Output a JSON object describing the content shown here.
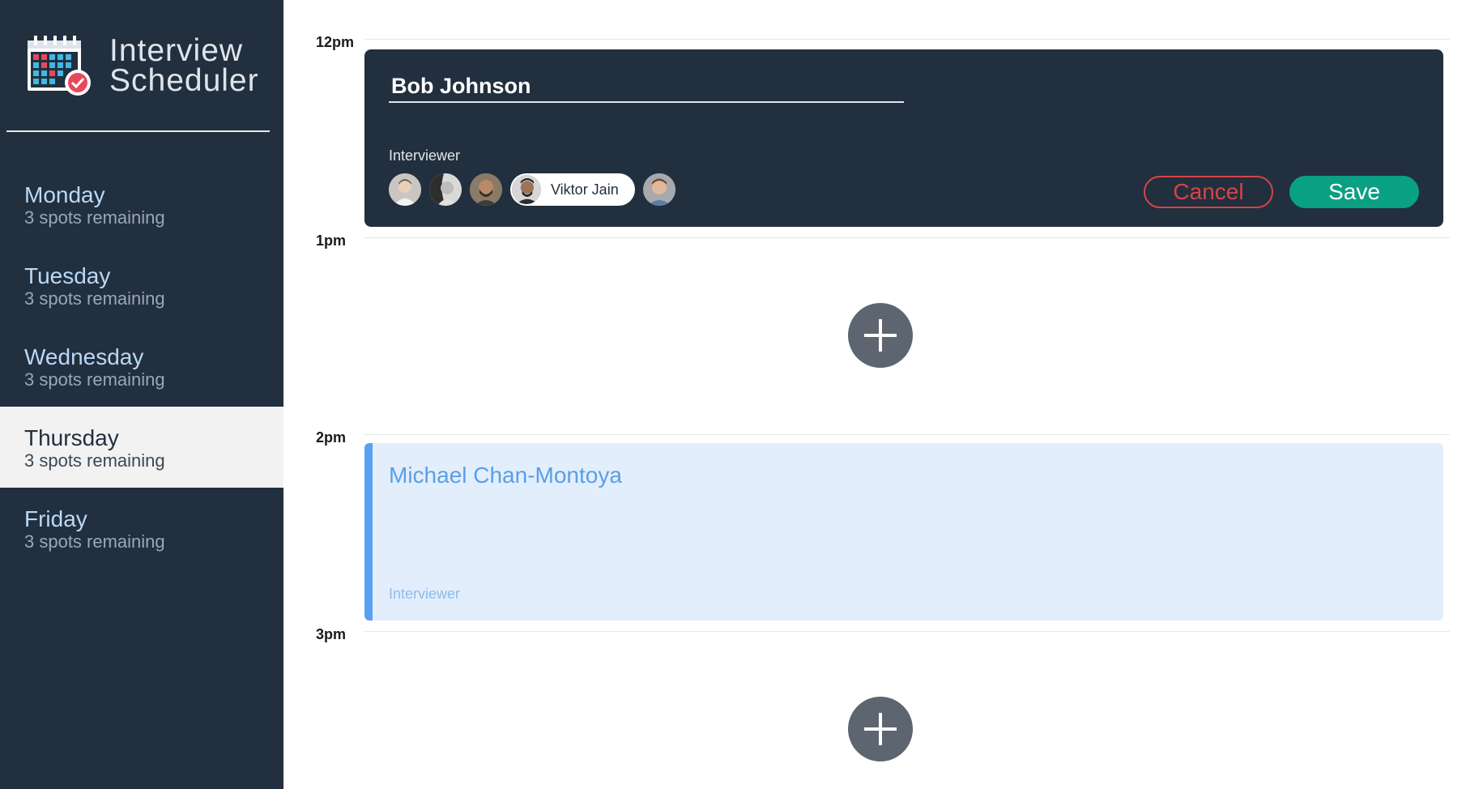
{
  "app": {
    "title_line1": "Interview",
    "title_line2": "Scheduler",
    "logo_icon": "calendar-check-icon"
  },
  "days": [
    {
      "name": "Monday",
      "spots": "3 spots remaining",
      "selected": false
    },
    {
      "name": "Tuesday",
      "spots": "3 spots remaining",
      "selected": false
    },
    {
      "name": "Wednesday",
      "spots": "3 spots remaining",
      "selected": false
    },
    {
      "name": "Thursday",
      "spots": "3 spots remaining",
      "selected": true
    },
    {
      "name": "Friday",
      "spots": "3 spots remaining",
      "selected": false
    }
  ],
  "schedule": {
    "hours": [
      "12pm",
      "1pm",
      "2pm",
      "3pm"
    ],
    "edit_form": {
      "student_name": "Bob Johnson",
      "interviewer_label": "Interviewer",
      "selected_interviewer": "Viktor Jain",
      "cancel_label": "Cancel",
      "save_label": "Save"
    },
    "appointment": {
      "student": "Michael Chan-Montoya",
      "interviewer_label": "Interviewer"
    }
  },
  "colors": {
    "sidebar_bg": "#222f3e",
    "cancel": "#d64545",
    "save": "#0aa084",
    "appointment_accent": "#59a0f2",
    "appointment_bg": "#e3eefc",
    "add_button": "#5d6571"
  }
}
